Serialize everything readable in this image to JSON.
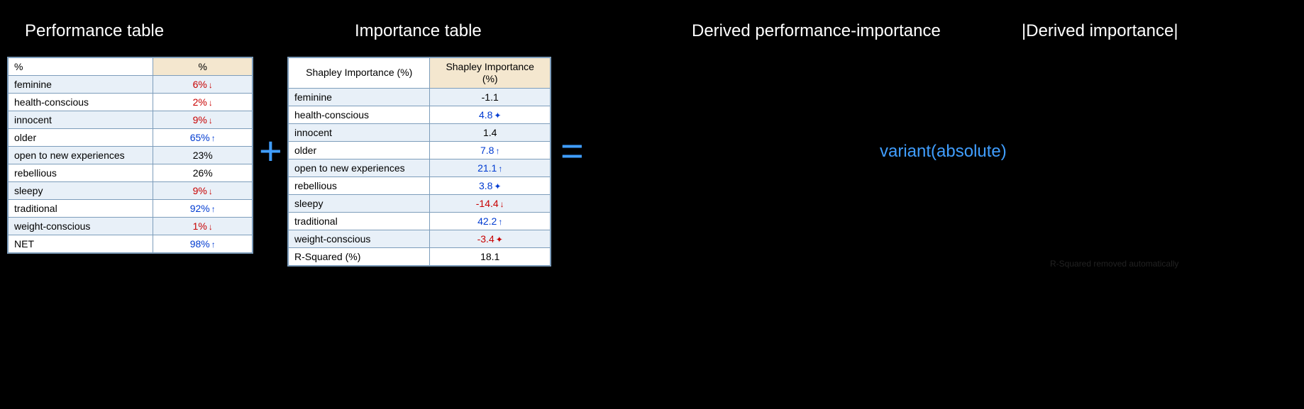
{
  "headings": {
    "performance": "Performance table",
    "importance": "Importance table",
    "derived": "Derived performance-importance",
    "derived_abs": "|Derived importance|"
  },
  "operators": {
    "plus": "+",
    "equals": "=",
    "variant": "variant(absolute)"
  },
  "table1": {
    "header_left": "%",
    "header_right": "%",
    "rows": [
      {
        "label": "feminine",
        "value": "6%",
        "color": "red",
        "arrow": "↓"
      },
      {
        "label": "health-conscious",
        "value": "2%",
        "color": "red",
        "arrow": "↓"
      },
      {
        "label": "innocent",
        "value": "9%",
        "color": "red",
        "arrow": "↓"
      },
      {
        "label": "older",
        "value": "65%",
        "color": "blue",
        "arrow": "↑"
      },
      {
        "label": "open to new experiences",
        "value": "23%",
        "color": "black",
        "arrow": ""
      },
      {
        "label": "rebellious",
        "value": "26%",
        "color": "black",
        "arrow": ""
      },
      {
        "label": "sleepy",
        "value": "9%",
        "color": "red",
        "arrow": "↓"
      },
      {
        "label": "traditional",
        "value": "92%",
        "color": "blue",
        "arrow": "↑"
      },
      {
        "label": "weight-conscious",
        "value": "1%",
        "color": "red",
        "arrow": "↓"
      },
      {
        "label": "NET",
        "value": "98%",
        "color": "blue",
        "arrow": "↑"
      }
    ]
  },
  "table2": {
    "header_left": "Shapley Importance (%)",
    "header_right": "Shapley Importance\n(%)",
    "rows": [
      {
        "label": "feminine",
        "value": "-1.1",
        "color": "black",
        "arrow": ""
      },
      {
        "label": "health-conscious",
        "value": "4.8",
        "color": "blue",
        "arrow": "✦"
      },
      {
        "label": "innocent",
        "value": "1.4",
        "color": "black",
        "arrow": ""
      },
      {
        "label": "older",
        "value": "7.8",
        "color": "blue",
        "arrow": "↑"
      },
      {
        "label": "open to new experiences",
        "value": "21.1",
        "color": "blue",
        "arrow": "↑"
      },
      {
        "label": "rebellious",
        "value": "3.8",
        "color": "blue",
        "arrow": "✦"
      },
      {
        "label": "sleepy",
        "value": "-14.4",
        "color": "red",
        "arrow": "↓"
      },
      {
        "label": "traditional",
        "value": "42.2",
        "color": "blue",
        "arrow": "↑"
      },
      {
        "label": "weight-conscious",
        "value": "-3.4",
        "color": "red",
        "arrow": "✦"
      },
      {
        "label": "R-Squared (%)",
        "value": "18.1",
        "color": "black",
        "arrow": ""
      }
    ]
  },
  "below_label": "R-Squared removed automatically"
}
